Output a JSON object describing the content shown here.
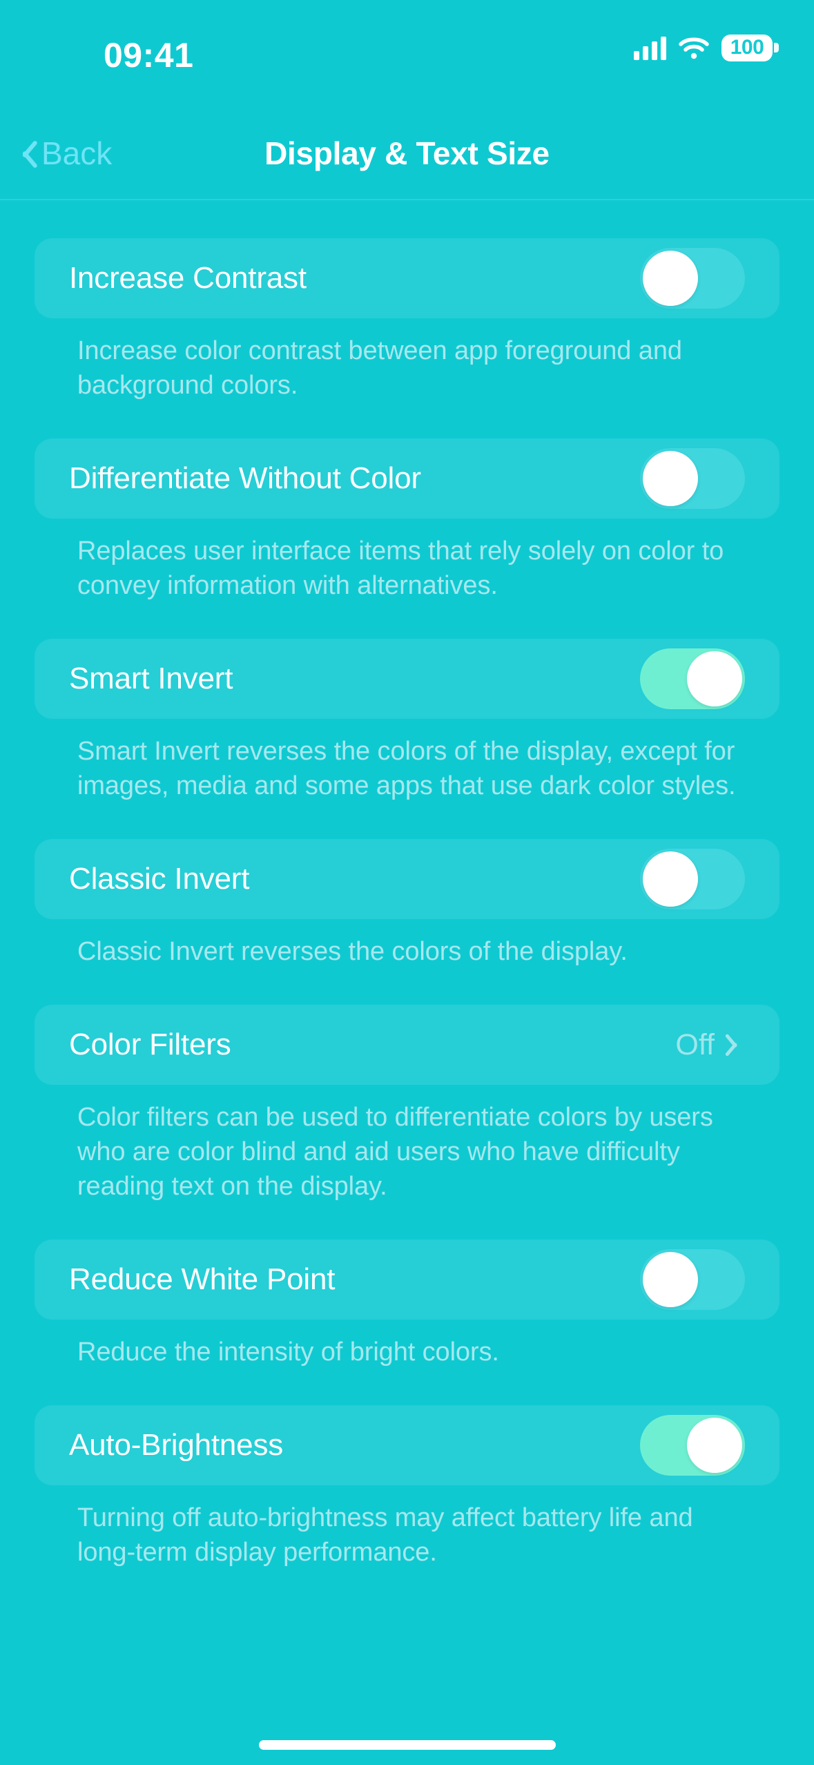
{
  "status_bar": {
    "time": "09:41",
    "signal_icon": "cellular-signal-icon",
    "wifi_icon": "wifi-icon",
    "battery_level": "100"
  },
  "nav": {
    "back_label": "Back",
    "title": "Display & Text Size"
  },
  "colors": {
    "background": "#0FC9D1",
    "card": "#26CED6",
    "toggle_on": "#6FEFD2",
    "toggle_off": "#3FD6DE",
    "accent_link": "#6FE4F5",
    "footer_text": "#A6E8EE",
    "primary_text": "#FFFFFF"
  },
  "settings": [
    {
      "label": "Increase Contrast",
      "control": "toggle",
      "state": "off",
      "footer": "Increase color contrast between app foreground and background colors."
    },
    {
      "label": "Differentiate Without Color",
      "control": "toggle",
      "state": "off",
      "footer": "Replaces user interface items that rely solely on color to convey information with alternatives."
    },
    {
      "label": "Smart Invert",
      "control": "toggle",
      "state": "on",
      "footer": "Smart Invert reverses the colors of the display, except for images, media and some apps that use dark color styles."
    },
    {
      "label": "Classic Invert",
      "control": "toggle",
      "state": "off",
      "footer": "Classic Invert reverses the colors of the display."
    },
    {
      "label": "Color Filters",
      "control": "disclosure",
      "value": "Off",
      "footer": "Color filters can be used to differentiate colors by users who are color blind and aid users who have difficulty reading text on the display."
    },
    {
      "label": "Reduce White Point",
      "control": "toggle",
      "state": "off",
      "footer": "Reduce the intensity of bright colors."
    },
    {
      "label": "Auto-Brightness",
      "control": "toggle",
      "state": "on",
      "footer": "Turning off auto-brightness may affect battery life and long-term display performance."
    }
  ]
}
